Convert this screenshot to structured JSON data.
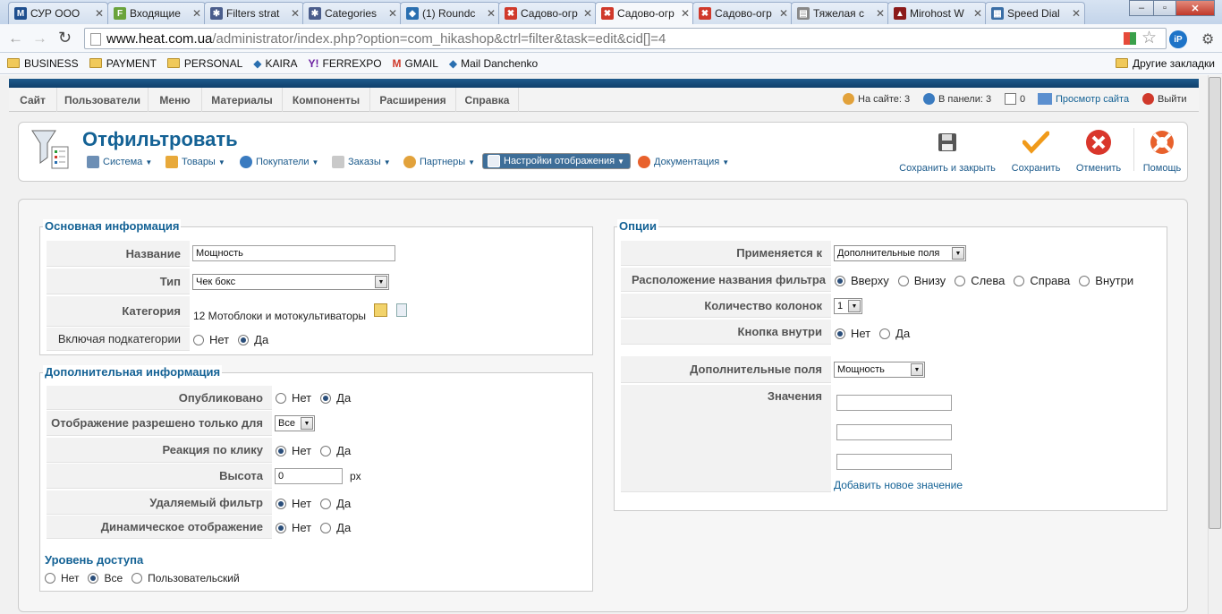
{
  "browser": {
    "tabs": [
      {
        "title": "СУР ООО",
        "fav": "M",
        "color": "#1f4f8f"
      },
      {
        "title": "Входящие",
        "fav": "F",
        "color": "#6aa33b"
      },
      {
        "title": "Filters strat",
        "fav": "✱",
        "color": "#4a5d8c"
      },
      {
        "title": "Categories",
        "fav": "✱",
        "color": "#4a5d8c"
      },
      {
        "title": "(1) Roundc",
        "fav": "◆",
        "color": "#2a6fb0"
      },
      {
        "title": "Садово-огр",
        "fav": "✖",
        "color": "#d0392b"
      },
      {
        "title": "Садово-огр",
        "fav": "✖",
        "color": "#d0392b"
      },
      {
        "title": "Садово-огр",
        "fav": "✖",
        "color": "#d0392b"
      },
      {
        "title": "Тяжелая с",
        "fav": "▤",
        "color": "#888888"
      },
      {
        "title": "Mirohost W",
        "fav": "▲",
        "color": "#8b1a1a"
      },
      {
        "title": "Speed Dial",
        "fav": "▦",
        "color": "#3a6ea5"
      }
    ],
    "url_host": "www.heat.com.ua",
    "url_path": "/administrator/index.php?option=com_hikashop&ctrl=filter&task=edit&cid[]=4",
    "bookmarks": [
      "BUSINESS",
      "PAYMENT",
      "PERSONAL",
      "KAIRA",
      "FERREXPO",
      "GMAIL",
      "Mail Danchenko"
    ],
    "other_bookmarks": "Другие закладки"
  },
  "menu": {
    "items": [
      "Сайт",
      "Пользователи",
      "Меню",
      "Материалы",
      "Компоненты",
      "Расширения",
      "Справка"
    ],
    "on_site": "На сайте: 3",
    "in_panel": "В панели: 3",
    "messages": "0",
    "view_site": "Просмотр сайта",
    "logout": "Выйти"
  },
  "toolbar": {
    "title": "Отфильтровать",
    "subs": [
      "Система",
      "Товары",
      "Покупатели",
      "Заказы",
      "Партнеры",
      "Настройки отображения",
      "Документация"
    ],
    "save_close": "Сохранить и закрыть",
    "save": "Сохранить",
    "cancel": "Отменить",
    "help": "Помощь"
  },
  "main_info": {
    "legend": "Основная информация",
    "name_label": "Название",
    "name_value": "Мощность",
    "type_label": "Тип",
    "type_value": "Чек бокс",
    "category_label": "Категория",
    "category_value": "12 Мотоблоки и мотокультиваторы",
    "subcat_label": "Включая подкатегории",
    "no": "Нет",
    "yes": "Да"
  },
  "extra_info": {
    "legend": "Дополнительная информация",
    "published_label": "Опубликовано",
    "display_only_label": "Отображение разрешено только для",
    "display_only_value": "Все",
    "click_label": "Реакция по клику",
    "height_label": "Высота",
    "height_value": "0",
    "height_unit": "px",
    "removable_label": "Удаляемый фильтр",
    "dynamic_label": "Динамическое отображение",
    "no": "Нет",
    "yes": "Да",
    "access_title": "Уровень доступа",
    "access_none": "Нет",
    "access_all": "Все",
    "access_custom": "Пользовательский"
  },
  "options": {
    "legend": "Опции",
    "applies_label": "Применяется к",
    "applies_value": "Дополнительные поля",
    "title_pos_label": "Расположение названия фильтра",
    "pos_top": "Вверху",
    "pos_bottom": "Внизу",
    "pos_left": "Слева",
    "pos_right": "Справа",
    "pos_inside": "Внутри",
    "columns_label": "Количество колонок",
    "columns_value": "1",
    "button_inside_label": "Кнопка внутри",
    "no": "Нет",
    "yes": "Да",
    "extra_fields_label": "Дополнительные поля",
    "extra_fields_value": "Мощность",
    "values_label": "Значения",
    "add_value": "Добавить новое значение"
  }
}
